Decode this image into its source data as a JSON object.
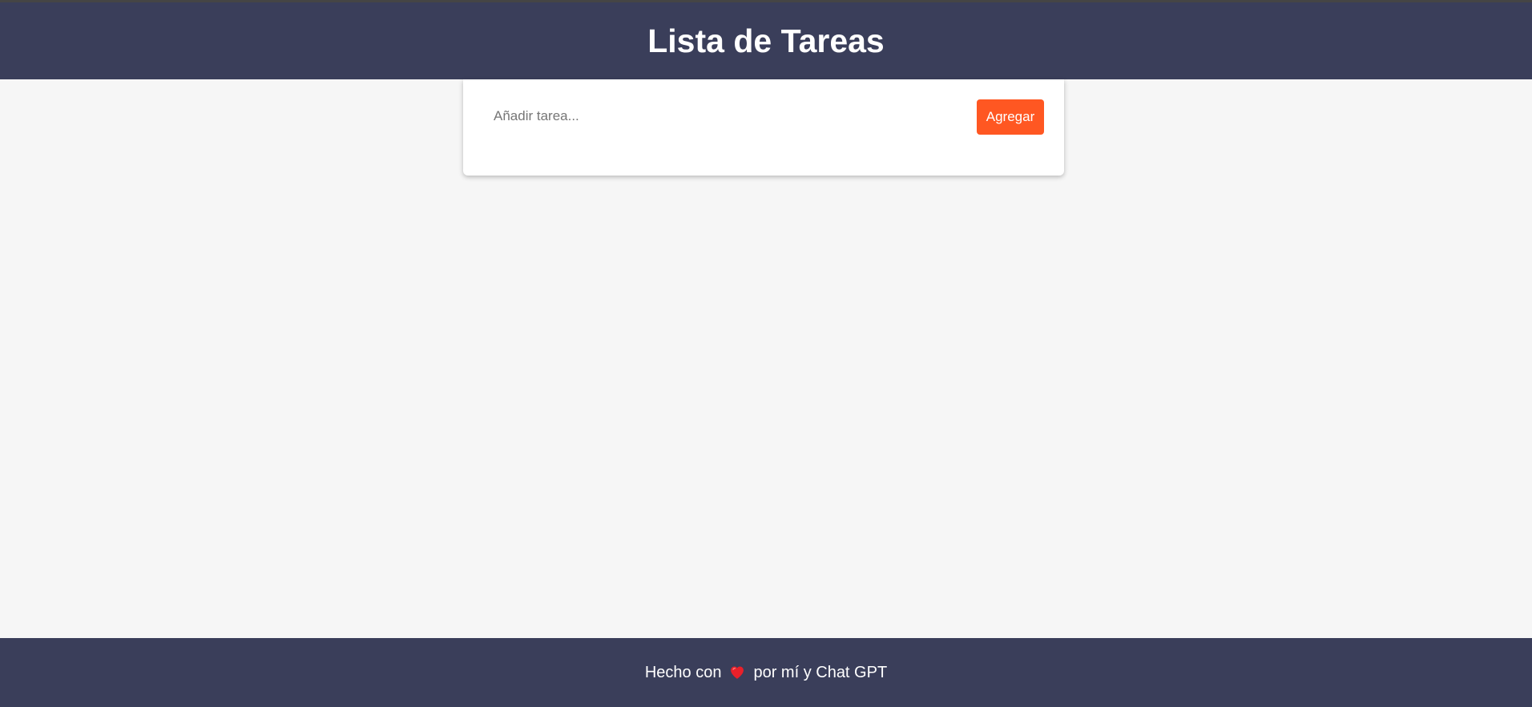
{
  "header": {
    "title": "Lista de Tareas"
  },
  "task_form": {
    "input_placeholder": "Añadir tarea...",
    "input_value": "",
    "add_button_label": "Agregar"
  },
  "footer": {
    "text_before": "Hecho con",
    "icon": "heart-icon",
    "text_after": "por mí y Chat GPT"
  },
  "colors": {
    "header_bg": "#3a3e5a",
    "accent": "#ff5722",
    "page_bg": "#f6f6f6"
  }
}
